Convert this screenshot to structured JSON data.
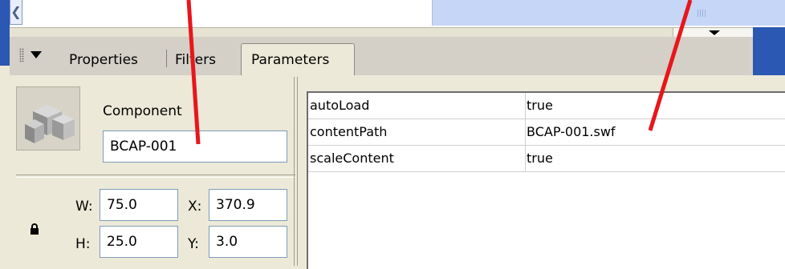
{
  "tabs": {
    "properties": "Properties",
    "filters": "Filters",
    "parameters": "Parameters"
  },
  "component": {
    "label": "Component",
    "instance_name": "BCAP-001"
  },
  "size_position": {
    "w_label": "W:",
    "w_value": "75.0",
    "h_label": "H:",
    "h_value": "25.0",
    "x_label": "X:",
    "x_value": "370.9",
    "y_label": "Y:",
    "y_value": "3.0"
  },
  "parameters": [
    {
      "name": "autoLoad",
      "value": "true"
    },
    {
      "name": "contentPath",
      "value": "BCAP-001.swf"
    },
    {
      "name": "scaleContent",
      "value": "true"
    }
  ],
  "annotation_color": "#e8161b"
}
